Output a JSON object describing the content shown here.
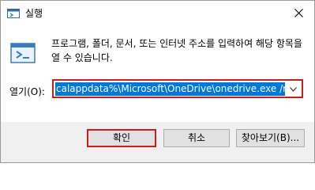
{
  "window": {
    "title": "실행",
    "close_symbol": "✕",
    "icon": "run-app-icon"
  },
  "dialog": {
    "description": "프로그램, 폴더, 문서, 또는 인터넷 주소를 입력하여 해당 항목을 열 수 있습니다.",
    "open_label": "열기(O):",
    "open_value": "calappdata%\\Microsoft\\OneDrive\\onedrive.exe /reset",
    "dropdown_icon": "chevron-down-icon"
  },
  "buttons": {
    "ok": "확인",
    "cancel": "취소",
    "browse": "찾아보기(B)..."
  },
  "colors": {
    "highlight": "#c81e1e",
    "selection": "#0078d7"
  }
}
